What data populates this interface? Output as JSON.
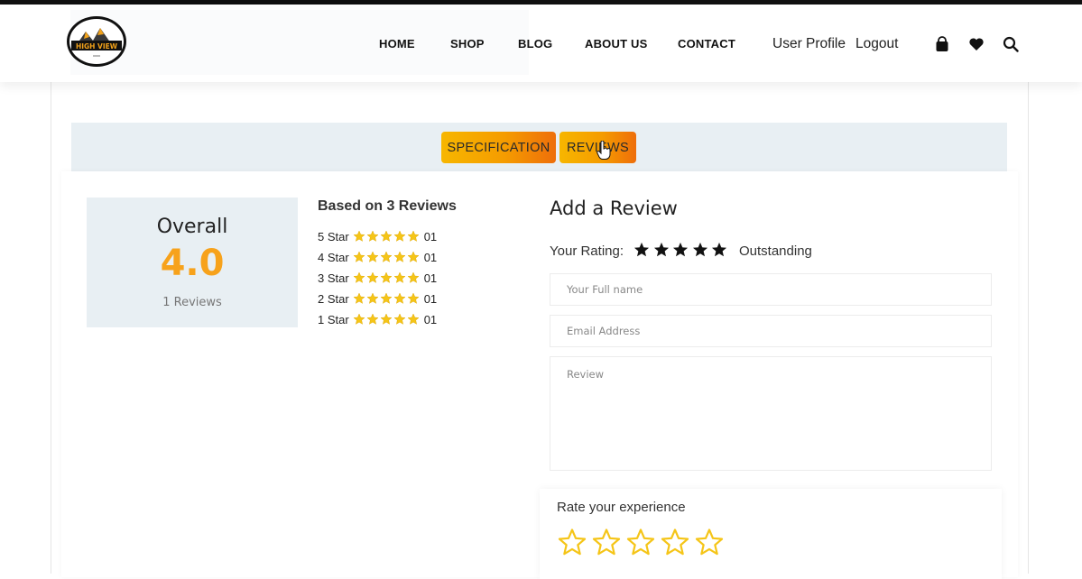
{
  "header": {
    "logo_text": "HIGH VIEW",
    "nav": [
      "HOME",
      "SHOP",
      "BLOG",
      "ABOUT US",
      "CONTACT"
    ],
    "user_profile": "User Profile",
    "logout": "Logout",
    "icons": [
      "bag-icon",
      "heart-icon",
      "search-icon"
    ]
  },
  "tabs": {
    "specification": "SPECIFICATION",
    "reviews": "REVIEWS",
    "active": "REVIEWS"
  },
  "overall": {
    "title": "Overall",
    "score": "4.0",
    "count": "1 Reviews"
  },
  "breakdown": {
    "title": "Based on 3 Reviews",
    "rows": [
      {
        "label": "5 Star",
        "count": "01",
        "stars": 5
      },
      {
        "label": "4 Star",
        "count": "01",
        "stars": 5
      },
      {
        "label": "3 Star",
        "count": "01",
        "stars": 5
      },
      {
        "label": "2 Star",
        "count": "01",
        "stars": 5
      },
      {
        "label": "1 Star",
        "count": "01",
        "stars": 5
      }
    ]
  },
  "add_review": {
    "title": "Add a Review",
    "rating_label": "Your Rating:",
    "rating_stars": 5,
    "rating_word": "Outstanding",
    "name_placeholder": "Your Full name",
    "email_placeholder": "Email Address",
    "review_placeholder": "Review"
  },
  "experience": {
    "title": "Rate your experience",
    "stars_total": 5,
    "stars_selected": 0
  },
  "colors": {
    "accent_orange": "#f7a21b",
    "star_yellow": "#f5c518",
    "panel_bg": "#e8eff3"
  }
}
